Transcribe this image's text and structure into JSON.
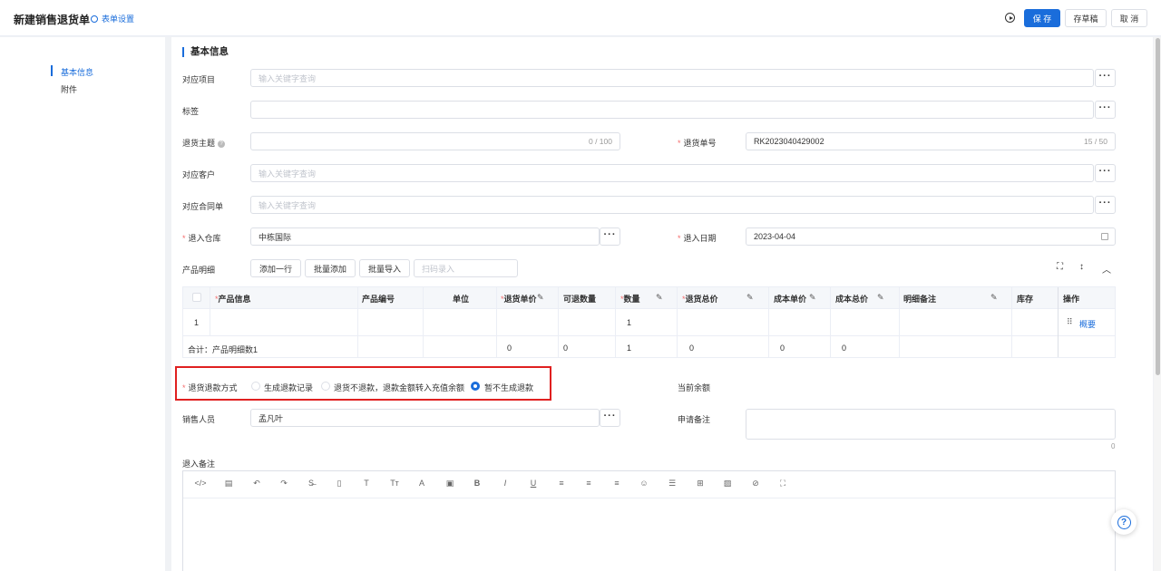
{
  "header": {
    "title": "新建销售退货单",
    "form_settings": "表单设置",
    "save": "保 存",
    "draft": "存草稿",
    "cancel": "取 消"
  },
  "sidenav": [
    "基本信息",
    "附件"
  ],
  "section_title": "基本信息",
  "fields": {
    "project": {
      "label": "对应项目",
      "placeholder": "输入关键字查询"
    },
    "tags": {
      "label": "标签"
    },
    "subject": {
      "label": "退货主题",
      "count": "0 / 100"
    },
    "return_no": {
      "label": "退货单号",
      "value": "RK2023040429002",
      "count": "15 / 50"
    },
    "customer": {
      "label": "对应客户",
      "placeholder": "输入关键字查询"
    },
    "contract": {
      "label": "对应合同单",
      "placeholder": "输入关键字查询"
    },
    "warehouse": {
      "label": "退入仓库",
      "value": "中栋国际"
    },
    "return_date": {
      "label": "退入日期",
      "value": "2023-04-04"
    },
    "sales_person": {
      "label": "销售人员",
      "value": "孟凡叶"
    },
    "apply_note": {
      "label": "申请备注",
      "count": "0"
    },
    "current_balance": {
      "label": "当前余额"
    },
    "return_note": {
      "label": "退入备注"
    }
  },
  "product": {
    "label": "产品明细",
    "add_row": "添加一行",
    "batch_add": "批量添加",
    "batch_import": "批量导入",
    "scan_placeholder": "扫码录入",
    "columns": [
      "产品信息",
      "产品编号",
      "单位",
      "退货单价",
      "可退数量",
      "数量",
      "退货总价",
      "成本单价",
      "成本总价",
      "明细备注",
      "库存",
      "操作"
    ],
    "row": {
      "index": "1",
      "qty": "1",
      "action": "概要"
    },
    "total": {
      "label": "合计：产品明细数1",
      "unit_price": "0",
      "returnable": "0",
      "qty": "1",
      "total_price": "0",
      "cost_unit": "0",
      "cost_total": "0"
    }
  },
  "refund": {
    "label": "退货退款方式",
    "options": [
      "生成退款记录",
      "退货不退款，退款金额转入充值余额",
      "暂不生成退款"
    ],
    "selected": "暂不生成退款"
  },
  "help": "?"
}
